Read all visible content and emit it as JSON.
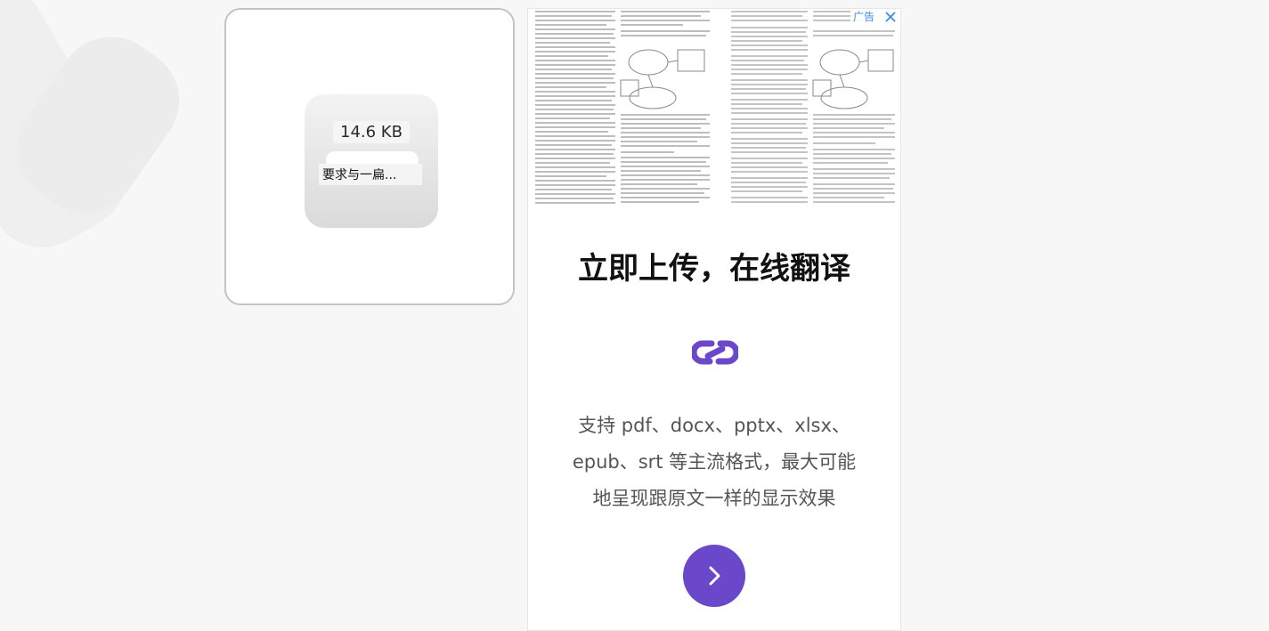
{
  "file_card": {
    "size": "14.6 KB",
    "name": "要求与一扁..."
  },
  "ad": {
    "badge": "广告",
    "headline": "立即上传，在线翻译",
    "description_lines": [
      "支持 pdf、docx、pptx、xlsx、",
      "epub、srt 等主流格式，最大可能",
      "地呈现跟原文一样的显示效果"
    ],
    "accent_color": "#6a48c9",
    "badge_color": "#3b8de5"
  },
  "icons": {
    "close": "close-icon",
    "logo": "link-logo-icon",
    "cta": "chevron-right-icon"
  }
}
